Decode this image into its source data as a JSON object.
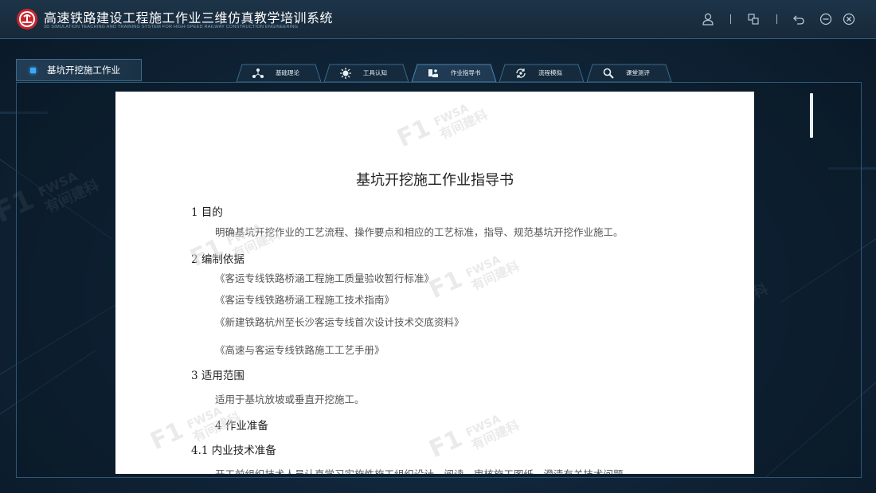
{
  "app": {
    "title": "高速铁路建设工程施工作业三维仿真教学培训系统",
    "subtitle": "3D SIMULATION TEACHING AND TRAINING SYSTEM FOR HIGH-SPEED RAILWAY CONSTRUCTION ENGINEERING",
    "logo_icon": "railway-logo-icon"
  },
  "toolbar": {
    "icons": [
      "user-icon",
      "window-switch-icon",
      "back-icon",
      "minimize-icon",
      "close-icon"
    ]
  },
  "section": {
    "label": "基坑开挖施工作业"
  },
  "tabs": [
    {
      "label": "基础理论",
      "icon": "network-icon"
    },
    {
      "label": "工具认知",
      "icon": "gear-sun-icon"
    },
    {
      "label": "作业指导书",
      "icon": "book-hand-icon"
    },
    {
      "label": "流程模拟",
      "icon": "cycle-icon"
    },
    {
      "label": "课堂测评",
      "icon": "search-icon"
    }
  ],
  "active_tab": "作业指导书",
  "document": {
    "title": "基坑开挖施工作业指导书",
    "lines": [
      {
        "kind": "heading",
        "text": "1 目的"
      },
      {
        "kind": "para",
        "text": "明确基坑开挖作业的工艺流程、操作要点和相应的工艺标准，指导、规范基坑开挖作业施工。"
      },
      {
        "kind": "heading",
        "text": "2 编制依据"
      },
      {
        "kind": "para",
        "text": "《客运专线铁路桥涵工程施工质量验收暂行标准》"
      },
      {
        "kind": "para",
        "text": "《客运专线铁路桥涵工程施工技术指南》"
      },
      {
        "kind": "para",
        "text": "《新建铁路杭州至长沙客运专线首次设计技术交底资料》"
      },
      {
        "kind": "para",
        "text": "《高速与客运专线铁路施工工艺手册》"
      },
      {
        "kind": "heading",
        "text": "3 适用范围"
      },
      {
        "kind": "para",
        "text": "适用于基坑放坡或垂直开挖施工。"
      },
      {
        "kind": "heading",
        "text": "4 作业准备"
      },
      {
        "kind": "heading",
        "text": "4.1 内业技术准备"
      },
      {
        "kind": "para",
        "text": "开工前组织技术人员认真学习实施性施工组织设计，阅读、审核施工图纸，澄清有关技术问题，"
      }
    ]
  },
  "watermark": {
    "brand": "FWSA",
    "text": "有间建科"
  },
  "colors": {
    "accent": "#3aa9ff",
    "title_bar": "#17293a",
    "logo_red": "#c8262e"
  }
}
